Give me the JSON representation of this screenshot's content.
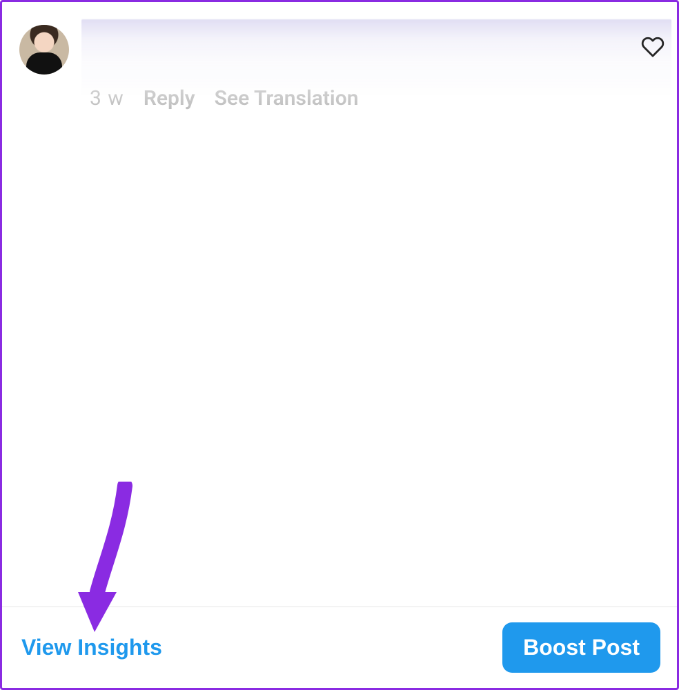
{
  "comment": {
    "time_label": "3 w",
    "reply_label": "Reply",
    "translate_label": "See Translation"
  },
  "icons": {
    "heart": "heart-outline-icon"
  },
  "actions": {
    "view_insights_label": "View Insights",
    "boost_post_label": "Boost Post"
  },
  "annotation": {
    "color": "#8a2be2"
  }
}
